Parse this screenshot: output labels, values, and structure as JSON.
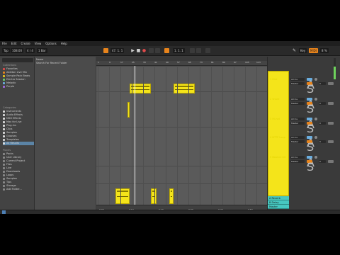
{
  "menu": [
    "File",
    "Edit",
    "Create",
    "View",
    "Options",
    "Help"
  ],
  "toolbar": {
    "tempo": "108.00",
    "tap_label": "Tap",
    "time_sig": "4 / 4",
    "quantize": "1 Bar",
    "position": "47. 1. 1",
    "loop_start": "1. 1. 1",
    "cpu": "8 %",
    "key_label": "Key",
    "midi_label": "MIDI"
  },
  "browser": {
    "collections_title": "Collections",
    "collections": [
      {
        "label": "Favorites",
        "color": "#e04b4b"
      },
      {
        "label": "Ableton Live Mix",
        "color": "#e8841c"
      },
      {
        "label": "Sample Pack Beats",
        "color": "#e8c31c"
      },
      {
        "label": "Electro Session",
        "color": "#6ad06a"
      },
      {
        "label": "Melodic",
        "color": "#6aaee0"
      },
      {
        "label": "Purple",
        "color": "#a06ae0"
      }
    ],
    "categories_title": "Categories",
    "categories": [
      {
        "label": "Instruments",
        "color": "#d9d9d9"
      },
      {
        "label": "Audio Effects",
        "color": "#d9d9d9"
      },
      {
        "label": "MIDI Effects",
        "color": "#d9d9d9"
      },
      {
        "label": "Max for Live",
        "color": "#d9d9d9"
      },
      {
        "label": "Plug-ins",
        "color": "#d9d9d9"
      },
      {
        "label": "Clips",
        "color": "#d9d9d9"
      },
      {
        "label": "Samples",
        "color": "#d9d9d9"
      },
      {
        "label": "Grooves",
        "color": "#d9d9d9"
      },
      {
        "label": "Templates",
        "color": "#d9d9d9"
      },
      {
        "label": "All Results",
        "color": "#d9d9d9"
      }
    ],
    "places_title": "Places",
    "places": [
      {
        "label": "Packs"
      },
      {
        "label": "User Library"
      },
      {
        "label": "Current Project"
      },
      {
        "label": "Files"
      },
      {
        "label": "Live"
      },
      {
        "label": "Downloads"
      },
      {
        "label": "Loops"
      },
      {
        "label": "Samples"
      },
      {
        "label": "Tips"
      },
      {
        "label": "Storage"
      },
      {
        "label": "Add Folder..."
      }
    ],
    "list_header": "Name",
    "list_row": "Search For Recent Folder"
  },
  "ruler": {
    "ticks": [
      "1",
      "9",
      "17",
      "25",
      "33",
      "41",
      "49",
      "57",
      "65",
      "73",
      "81",
      "89",
      "97",
      "105",
      "113"
    ],
    "bottom_ticks": [
      "0:00",
      "0:10",
      "0:20",
      "0:30",
      "0:40",
      "0:50"
    ]
  },
  "tracks": [
    {
      "name": "1 Kick",
      "send_a": "A",
      "send_b": "S",
      "input": "All Ins",
      "output": "Master",
      "value": "0"
    },
    {
      "name": "2 Snare",
      "send_a": "A",
      "send_b": "S",
      "input": "All Ins",
      "output": "Master",
      "value": "0"
    },
    {
      "name": "3 Hi-hat",
      "send_a": "A",
      "send_b": "S",
      "input": "All Ins",
      "output": "Master",
      "value": "0"
    },
    {
      "name": "4 NTTP Loop",
      "send_a": "A",
      "send_b": "S",
      "input": "All Ins",
      "output": "Master",
      "value": "0"
    },
    {
      "name": "5 Bounce Kit",
      "send_a": "A",
      "send_b": "S",
      "input": "All Ins",
      "output": "Master",
      "value": "0"
    }
  ],
  "returns": [
    {
      "name": "A Reverb"
    },
    {
      "name": "B Delay"
    },
    {
      "name": "Master"
    }
  ],
  "colors": {
    "accent": "#e8841c",
    "clip": "#f4e41a",
    "return": "#47c7c0",
    "selection": "#5b84a6"
  }
}
